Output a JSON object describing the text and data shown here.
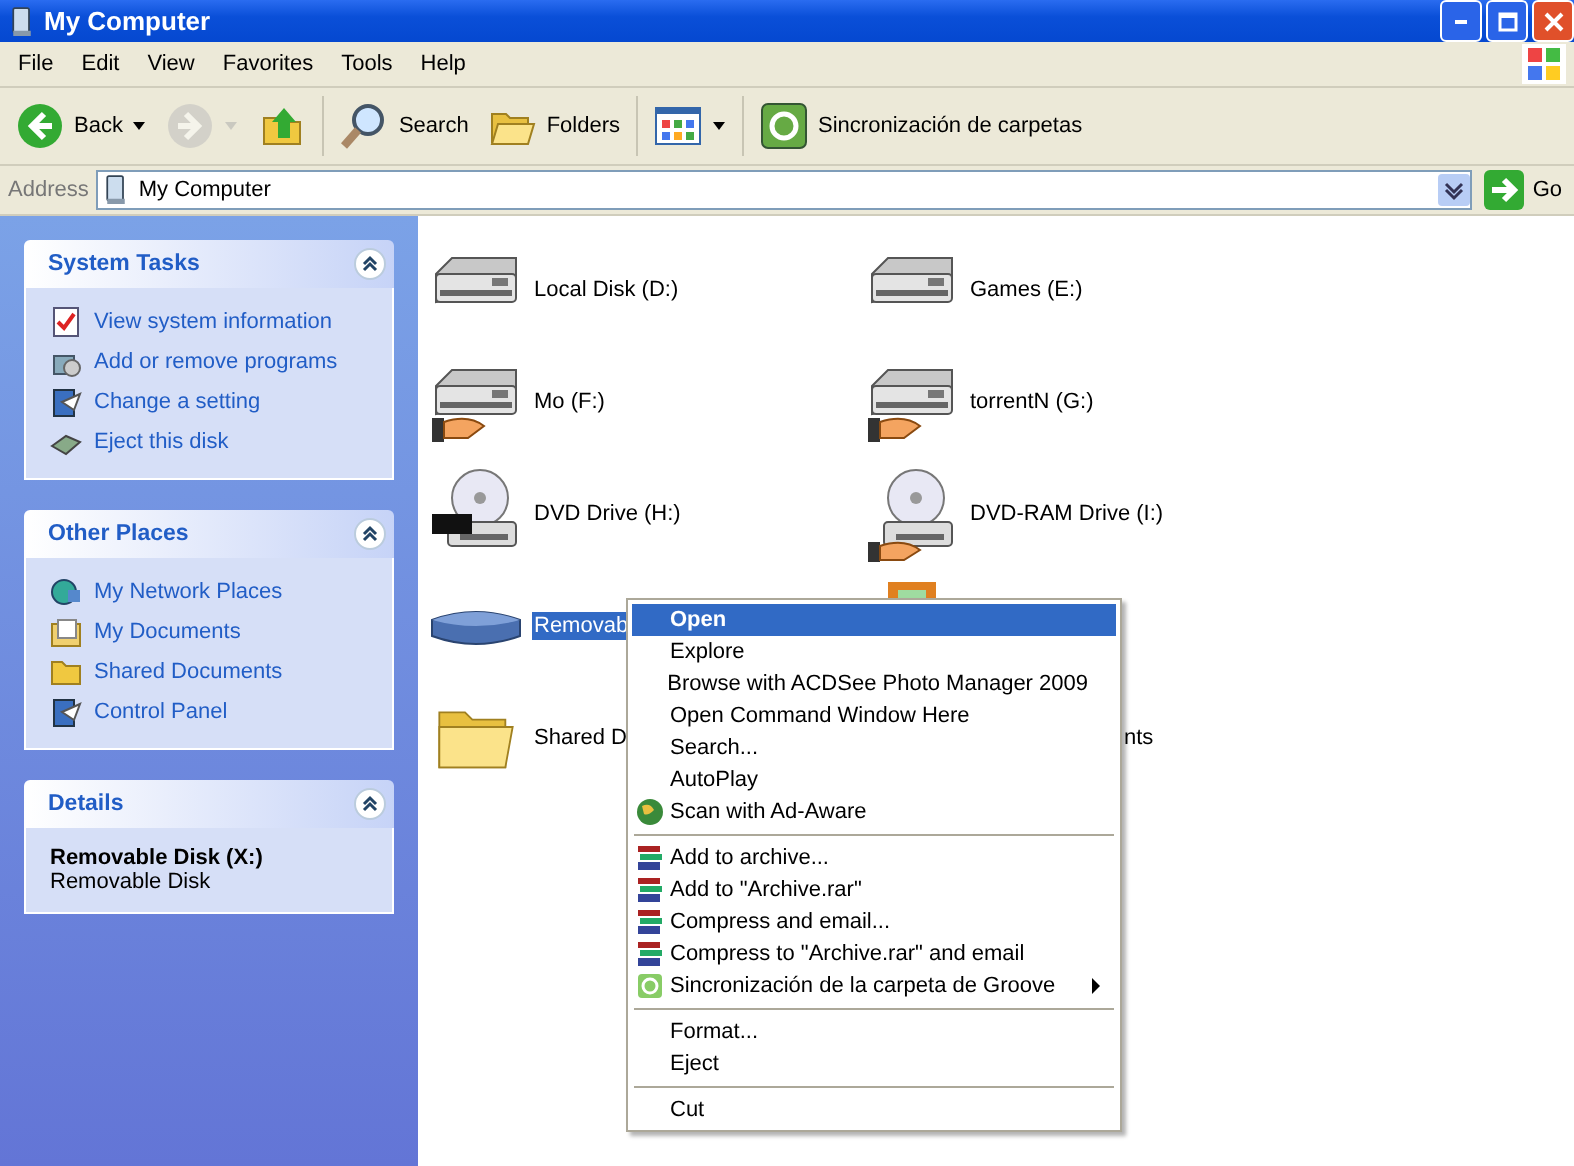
{
  "window": {
    "title": "My Computer"
  },
  "menu_bar": [
    "File",
    "Edit",
    "View",
    "Favorites",
    "Tools",
    "Help"
  ],
  "toolbar": [
    {
      "kind": "back",
      "label": "Back",
      "disabled": false
    },
    {
      "kind": "forward",
      "disabled": true
    },
    {
      "kind": "up",
      "disabled": false
    },
    {
      "kind": "search",
      "label": "Search",
      "disabled": false
    },
    {
      "kind": "folders",
      "label": "Folders",
      "disabled": false
    },
    {
      "kind": "views",
      "disabled": false
    },
    {
      "kind": "sync",
      "label": "Sincronización de carpetas",
      "disabled": false
    }
  ],
  "address_bar": {
    "label": "Address",
    "value": "My Computer",
    "go": "Go"
  },
  "sidebar": [
    {
      "title": "System Tasks",
      "expanded": true,
      "links": [
        {
          "label": "View system information",
          "kind": "sysinfo"
        },
        {
          "label": "Add or remove programs",
          "kind": "addremove"
        },
        {
          "label": "Change a setting",
          "kind": "setting"
        },
        {
          "label": "Eject this disk",
          "kind": "eject"
        }
      ]
    },
    {
      "title": "Other Places",
      "expanded": true,
      "links": [
        {
          "label": "My Network Places",
          "kind": "network"
        },
        {
          "label": "My Documents",
          "kind": "documents"
        },
        {
          "label": "Shared Documents",
          "kind": "folder"
        },
        {
          "label": "Control Panel",
          "kind": "setting"
        }
      ]
    },
    {
      "title": "Details",
      "expanded": true,
      "detail_name": "Removable Disk (X:)",
      "detail_type": "Removable Disk"
    }
  ],
  "items": [
    {
      "label": "Local Disk (D:)",
      "kind": "disk",
      "selected": false
    },
    {
      "label": "Games (E:)",
      "kind": "disk",
      "selected": false
    },
    {
      "label": "Mo (F:)",
      "kind": "shared-disk",
      "selected": false
    },
    {
      "label": "torrentN (G:)",
      "kind": "shared-disk",
      "selected": false
    },
    {
      "label": "DVD Drive (H:)",
      "kind": "dvd",
      "selected": false
    },
    {
      "label": "DVD-RAM Drive (I:)",
      "kind": "shared-dvd",
      "selected": false
    },
    {
      "label": "Removab",
      "kind": "removable",
      "selected": true
    },
    {
      "kind": "device"
    },
    {
      "label": "Shared D",
      "kind": "folder",
      "selected": false
    },
    {
      "label": "nts",
      "kind": "hidden-icon",
      "selected": false
    }
  ],
  "context_menu": [
    {
      "kind": "plain",
      "label": "Open",
      "default": true,
      "selected": true
    },
    {
      "kind": "plain",
      "label": "Explore",
      "selected": false
    },
    {
      "kind": "plain",
      "label": "Browse with ACDSee Photo Manager 2009",
      "selected": false
    },
    {
      "kind": "plain",
      "label": "Open Command Window Here",
      "selected": false
    },
    {
      "kind": "plain",
      "label": "Search...",
      "selected": false
    },
    {
      "kind": "plain",
      "label": "AutoPlay",
      "selected": false
    },
    {
      "kind": "globe",
      "label": "Scan with Ad-Aware",
      "selected": false
    },
    {
      "kind": "separator"
    },
    {
      "kind": "rar",
      "label": "Add to archive...",
      "selected": false
    },
    {
      "kind": "rar",
      "label": "Add to \"Archive.rar\"",
      "selected": false
    },
    {
      "kind": "rar",
      "label": "Compress and email...",
      "selected": false
    },
    {
      "kind": "rar",
      "label": "Compress to \"Archive.rar\" and email",
      "selected": false
    },
    {
      "kind": "sync",
      "label": "Sincronización de la carpeta de Groove",
      "submenu": true,
      "selected": false
    },
    {
      "kind": "separator"
    },
    {
      "kind": "plain",
      "label": "Format...",
      "selected": false
    },
    {
      "kind": "plain",
      "label": "Eject",
      "selected": false
    },
    {
      "kind": "separator"
    },
    {
      "kind": "plain",
      "label": "Cut",
      "selected": false
    }
  ]
}
